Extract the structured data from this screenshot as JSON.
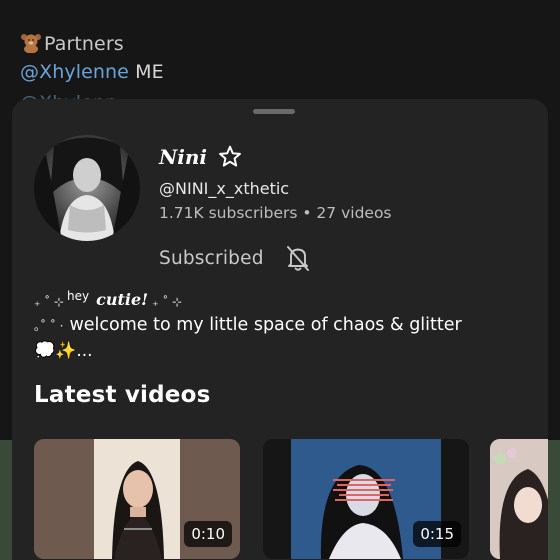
{
  "background": {
    "line1": "Partners",
    "line2_mention": "@Xhylenne",
    "line2_rest": " ME",
    "line3": "@Xhylenn",
    "bear_icon": "teddy-bear-emoji"
  },
  "profile": {
    "name": "Nini",
    "star_icon": "star-outline-icon",
    "handle": "@NINI_x_xthetic",
    "stats": "1.71K subscribers • 27 videos",
    "subscribed_label": "Subscribed",
    "bell_icon": "bell-off-icon"
  },
  "bio": {
    "line1_deco_left": "₊ ˚ ⊹",
    "line1_hey": "hey",
    "line1_cutie": "cutie!",
    "line1_deco_right": "₊ ˚ ⊹",
    "line2_deco": "｡˚ ˚ ·",
    "line2_text": "welcome to my little space of chaos & glitter",
    "line3": "💭✨..."
  },
  "latest_videos": {
    "heading": "Latest videos",
    "items": [
      {
        "duration": "0:10"
      },
      {
        "duration": "0:15"
      }
    ]
  },
  "colors": {
    "sheet": "#232323",
    "link": "#6aa3d8"
  }
}
